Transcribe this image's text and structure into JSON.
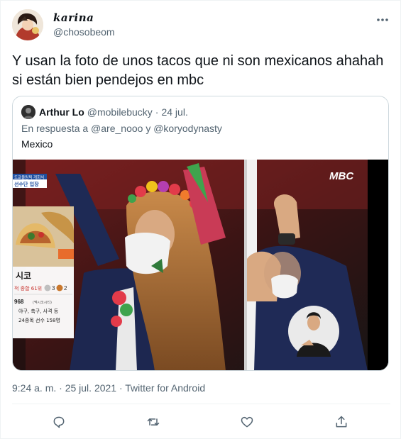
{
  "tweet": {
    "display_name": "karina",
    "handle": "@chosobeom",
    "text": "Y usan la foto de unos tacos que ni son mexicanos ahahah si están bien pendejos en mbc",
    "timestamp": "9:24 a. m. · 25 jul. 2021 · Twitter for Android",
    "more_icon": "more-horizontal-icon"
  },
  "quoted_tweet": {
    "name": "Arthur Lo",
    "handle": "@mobilebucky",
    "separator": "·",
    "date": "24 jul.",
    "reply_to": "En respuesta a @are_nooo y @koryodynasty",
    "text": "Mexico"
  },
  "media_overlay": {
    "broadcaster_logo": "MBC",
    "broadcast_tag": "도쿄올림픽 개회식",
    "segment_label": "선수단 입장",
    "country_label": "시코",
    "rank_line": "적 종합 61위",
    "medal_silver": "3",
    "medal_bronze": "2",
    "year": "968",
    "year_note": "(멕시코시티)",
    "sports_line": "야구, 축구, 사격 등",
    "athletes_line": "24종목 선수 158명"
  },
  "actions": [
    {
      "name": "reply-icon"
    },
    {
      "name": "retweet-icon"
    },
    {
      "name": "like-icon"
    },
    {
      "name": "share-icon"
    }
  ],
  "colors": {
    "text_primary": "#0f1419",
    "text_secondary": "#536471",
    "border": "#cfd9de",
    "divider": "#eff3f4"
  }
}
